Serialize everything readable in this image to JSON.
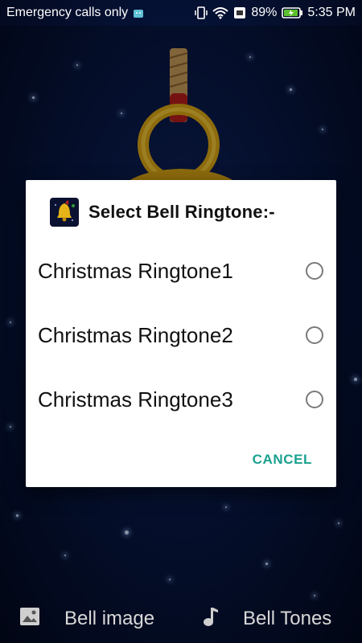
{
  "statusbar": {
    "carrier_text": "Emergency calls only",
    "battery_percent": "89%",
    "time": "5:35 PM"
  },
  "dialog": {
    "title": "Select Bell Ringtone:-",
    "options": [
      {
        "label": "Christmas Ringtone1",
        "selected": false
      },
      {
        "label": "Christmas Ringtone2",
        "selected": false
      },
      {
        "label": "Christmas Ringtone3",
        "selected": false
      }
    ],
    "cancel_label": "CANCEL"
  },
  "bottombar": {
    "left_label": "Bell image",
    "right_label": "Bell Tones"
  },
  "colors": {
    "accent": "#1aa190",
    "background": "#081845"
  }
}
